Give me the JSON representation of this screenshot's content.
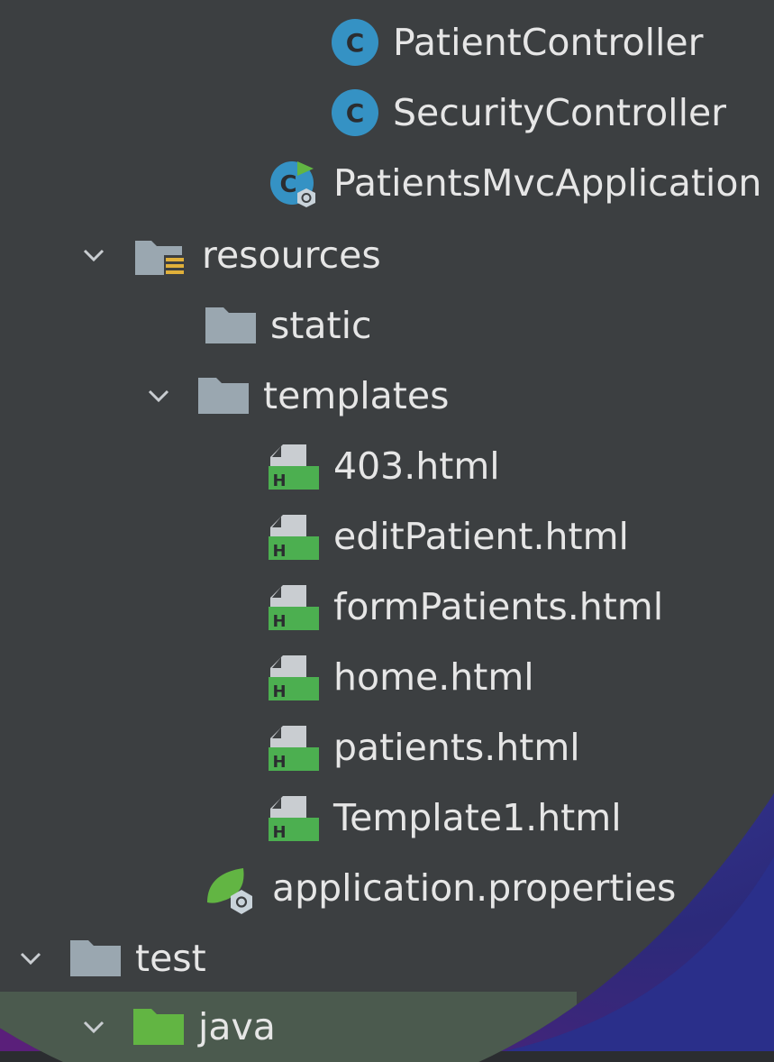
{
  "tree": {
    "items": [
      {
        "label": "PatientController",
        "icon": "class-icon"
      },
      {
        "label": "SecurityController",
        "icon": "class-icon"
      },
      {
        "label": "PatientsMvcApplication",
        "icon": "spring-boot-class-icon"
      },
      {
        "label": "resources",
        "icon": "resources-folder-icon"
      },
      {
        "label": "static",
        "icon": "folder-icon"
      },
      {
        "label": "templates",
        "icon": "folder-icon"
      },
      {
        "label": "403.html",
        "icon": "html-file-icon"
      },
      {
        "label": "editPatient.html",
        "icon": "html-file-icon"
      },
      {
        "label": "formPatients.html",
        "icon": "html-file-icon"
      },
      {
        "label": "home.html",
        "icon": "html-file-icon"
      },
      {
        "label": "patients.html",
        "icon": "html-file-icon"
      },
      {
        "label": "Template1.html",
        "icon": "html-file-icon"
      },
      {
        "label": "application.properties",
        "icon": "spring-properties-icon"
      },
      {
        "label": "test",
        "icon": "folder-icon"
      },
      {
        "label": "java",
        "icon": "test-sources-folder-icon"
      }
    ]
  },
  "colors": {
    "panel": "#3c3f41",
    "text": "#e6e6e6",
    "class_icon": "#3592c4",
    "folder": "#9aa7b0",
    "html_green": "#4caf50",
    "test_folder": "#62b543",
    "selection": "#4b5a4e"
  }
}
